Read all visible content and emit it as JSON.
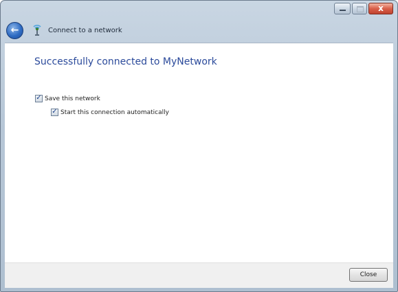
{
  "window": {
    "title": "Connect to a network",
    "caption_buttons": [
      "minimize",
      "maximize",
      "close"
    ],
    "close_glyph": "x"
  },
  "nav": {
    "back_glyph": "←",
    "icon": "network-icon"
  },
  "content": {
    "heading": "Successfully connected to MyNetwork",
    "options": [
      {
        "label": "Save this network",
        "checked": true
      },
      {
        "label": "Start this connection automatically",
        "checked": true
      }
    ]
  },
  "footer": {
    "close_label": "Close"
  },
  "colors": {
    "heading": "#2b4a9b",
    "frame": "#b7c7d7",
    "close_caption": "#c0432f"
  }
}
